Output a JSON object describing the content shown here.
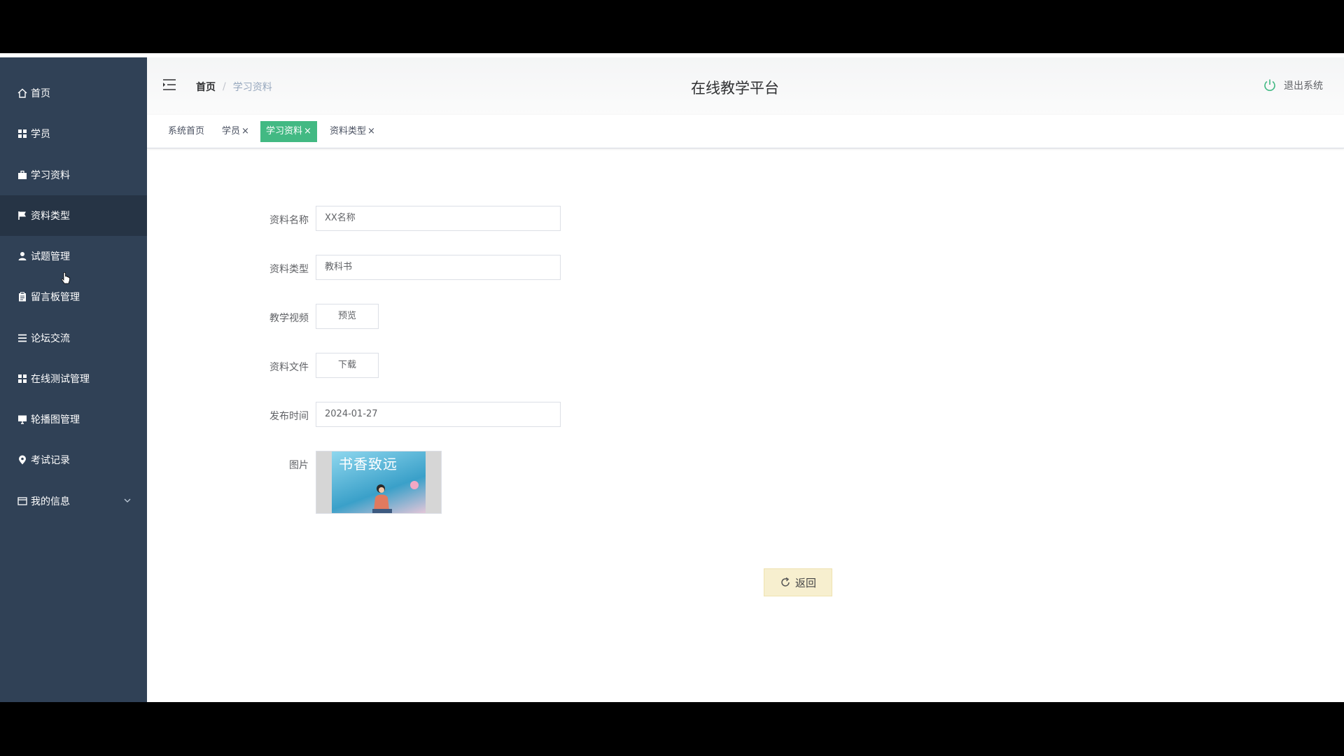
{
  "sidebar": {
    "items": [
      {
        "label": "首页",
        "icon": "home-icon"
      },
      {
        "label": "学员",
        "icon": "grid-icon"
      },
      {
        "label": "学习资料",
        "icon": "briefcase-icon"
      },
      {
        "label": "资料类型",
        "icon": "flag-icon",
        "active": true
      },
      {
        "label": "试题管理",
        "icon": "user-icon"
      },
      {
        "label": "留言板管理",
        "icon": "clipboard-icon"
      },
      {
        "label": "论坛交流",
        "icon": "list-icon"
      },
      {
        "label": "在线测试管理",
        "icon": "grid-icon"
      },
      {
        "label": "轮播图管理",
        "icon": "monitor-icon"
      },
      {
        "label": "考试记录",
        "icon": "pin-icon"
      },
      {
        "label": "我的信息",
        "icon": "card-icon",
        "expandable": true
      }
    ]
  },
  "navbar": {
    "breadcrumb": {
      "home": "首页",
      "separator": "/",
      "current": "学习资料"
    },
    "title": "在线教学平台",
    "logout": "退出系统"
  },
  "tags": [
    {
      "label": "系统首页",
      "closable": false
    },
    {
      "label": "学员",
      "closable": true
    },
    {
      "label": "学习资料",
      "closable": true,
      "active": true
    },
    {
      "label": "资料类型",
      "closable": true
    }
  ],
  "tag_close_glyph": "×",
  "form": {
    "name_label": "资料名称",
    "name_value": "XX名称",
    "type_label": "资料类型",
    "type_value": "教科书",
    "video_label": "教学视频",
    "video_button": "预览",
    "file_label": "资料文件",
    "file_button": "下载",
    "date_label": "发布时间",
    "date_value": "2024-01-27",
    "image_label": "图片",
    "image_cover_text": "书香致远"
  },
  "back_button": "返回",
  "colors": {
    "sidebar_bg": "#304156",
    "sidebar_active_bg": "#263445",
    "tag_active_bg": "#42b983",
    "back_button_bg": "#f7efcf"
  }
}
